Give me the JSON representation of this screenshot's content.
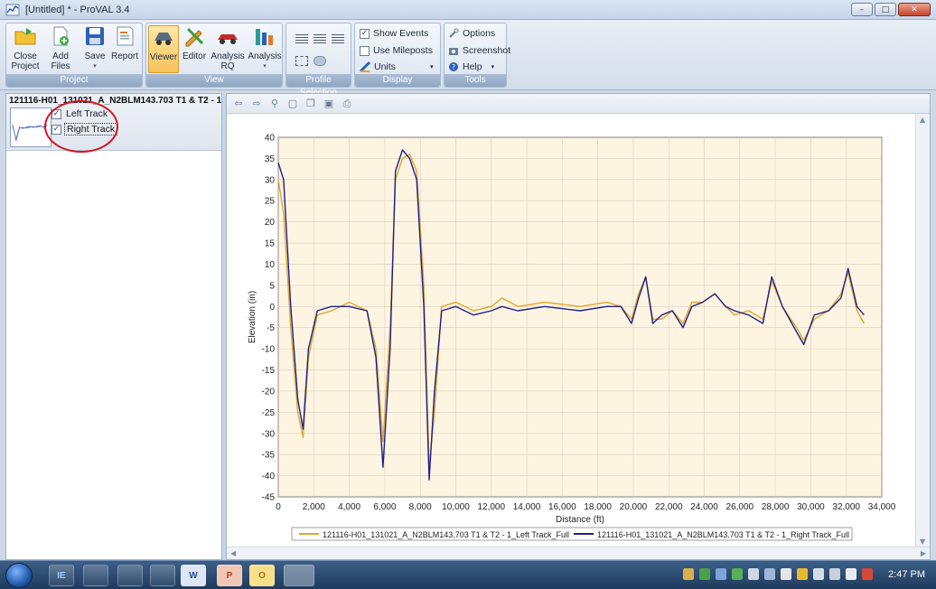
{
  "window": {
    "title": "[Untitled] * - ProVAL 3.4"
  },
  "window_controls": {
    "minimize": "–",
    "maximize": "□",
    "close": "✕"
  },
  "ribbon": {
    "project": {
      "label": "Project",
      "buttons": [
        "Close\nProject",
        "Add Files",
        "Save",
        "Report"
      ]
    },
    "view": {
      "label": "View",
      "buttons": [
        "Viewer",
        "Editor",
        "Analysis\nRQ",
        "Analysis"
      ]
    },
    "profile_selection": {
      "label": "Profile Selection"
    },
    "display": {
      "label": "Display",
      "show_events": "Show Events",
      "use_mileposts": "Use Mileposts",
      "units": "Units",
      "show_events_checked": true,
      "use_mileposts_checked": false
    },
    "tools": {
      "label": "Tools",
      "options": "Options",
      "screenshot": "Screenshot",
      "help": "Help"
    }
  },
  "left_panel": {
    "project_title": "121116-H01_131021_A_N2BLM143.703 T1 & T2 - 1",
    "tracks": [
      {
        "label": "Left Track",
        "checked": true
      },
      {
        "label": "Right Track",
        "checked": true
      }
    ]
  },
  "colors": {
    "left_track": "#e1a62a",
    "right_track": "#1f1f8c",
    "plot_bg": "#fdf5e2",
    "annotation": "#d4141d"
  },
  "chart_data": {
    "type": "line",
    "xlabel": "Distance (ft)",
    "ylabel": "Elevation (in)",
    "xlim": [
      0,
      34000
    ],
    "ylim": [
      -45,
      40
    ],
    "x_ticks": [
      "0",
      "2,000",
      "4,000",
      "6,000",
      "8,000",
      "10,000",
      "12,000",
      "14,000",
      "16,000",
      "18,000",
      "20,000",
      "22,000",
      "24,000",
      "26,000",
      "28,000",
      "30,000",
      "32,000",
      "34,000"
    ],
    "y_ticks": [
      "40",
      "35",
      "30",
      "25",
      "20",
      "15",
      "10",
      "5",
      "0",
      "-5",
      "-10",
      "-15",
      "-20",
      "-25",
      "-30",
      "-35",
      "-40",
      "-45"
    ],
    "grid": true,
    "legend_position": "bottom",
    "series": [
      {
        "name": "121116-H01_131021_A_N2BLM143.703 T1 & T2 - 1_Left Track_Full",
        "x": [
          0,
          300,
          700,
          1100,
          1400,
          1700,
          2200,
          3000,
          4000,
          5000,
          5500,
          5900,
          6300,
          6600,
          7000,
          7400,
          7800,
          8200,
          8500,
          8800,
          9200,
          10000,
          11000,
          12000,
          12600,
          13500,
          15000,
          17000,
          18500,
          19300,
          19900,
          20300,
          20700,
          21100,
          21600,
          22200,
          22800,
          23300,
          23900,
          24600,
          25200,
          25700,
          26500,
          27300,
          27800,
          28400,
          29200,
          29600,
          30200,
          31000,
          31700,
          32100,
          32600,
          33000
        ],
        "y": [
          30,
          22,
          -5,
          -25,
          -31,
          -12,
          -2,
          -1,
          1,
          -1,
          -10,
          -32,
          -5,
          30,
          35,
          36,
          32,
          5,
          -38,
          -25,
          0,
          1,
          -1,
          0,
          2,
          0,
          1,
          0,
          1,
          0,
          -3,
          3,
          7,
          -3,
          -3,
          -1,
          -4,
          1,
          1,
          3,
          0,
          -2,
          -1,
          -3,
          6,
          0,
          -5,
          -8,
          -3,
          -1,
          3,
          8,
          -1,
          -4
        ]
      },
      {
        "name": "121116-H01_131021_A_N2BLM143.703 T1 & T2 - 1_Right Track_Full",
        "x": [
          0,
          300,
          700,
          1100,
          1400,
          1700,
          2200,
          3000,
          4000,
          5000,
          5500,
          5900,
          6300,
          6600,
          7000,
          7400,
          7800,
          8200,
          8500,
          8800,
          9200,
          10000,
          11000,
          12000,
          12600,
          13500,
          15000,
          17000,
          18500,
          19300,
          19900,
          20300,
          20700,
          21100,
          21600,
          22200,
          22800,
          23300,
          23900,
          24600,
          25200,
          25700,
          26500,
          27300,
          27800,
          28400,
          29200,
          29600,
          30200,
          31000,
          31700,
          32100,
          32600,
          33000
        ],
        "y": [
          34,
          30,
          0,
          -22,
          -29,
          -10,
          -1,
          0,
          0,
          -1,
          -12,
          -38,
          -10,
          32,
          37,
          35,
          30,
          0,
          -41,
          -20,
          -1,
          0,
          -2,
          -1,
          0,
          -1,
          0,
          -1,
          0,
          0,
          -4,
          2,
          7,
          -4,
          -2,
          -1,
          -5,
          0,
          1,
          3,
          0,
          -1,
          -2,
          -4,
          7,
          0,
          -6,
          -9,
          -2,
          -1,
          2,
          9,
          0,
          -2
        ]
      }
    ]
  },
  "chart_toolbar_icons": [
    "back-arrow",
    "forward-arrow",
    "zoom",
    "fit",
    "copy",
    "save",
    "print"
  ],
  "taskbar": {
    "clock": "2:47 PM",
    "apps": [
      "IE",
      "",
      "",
      "",
      "W",
      "P",
      "O",
      ""
    ]
  }
}
